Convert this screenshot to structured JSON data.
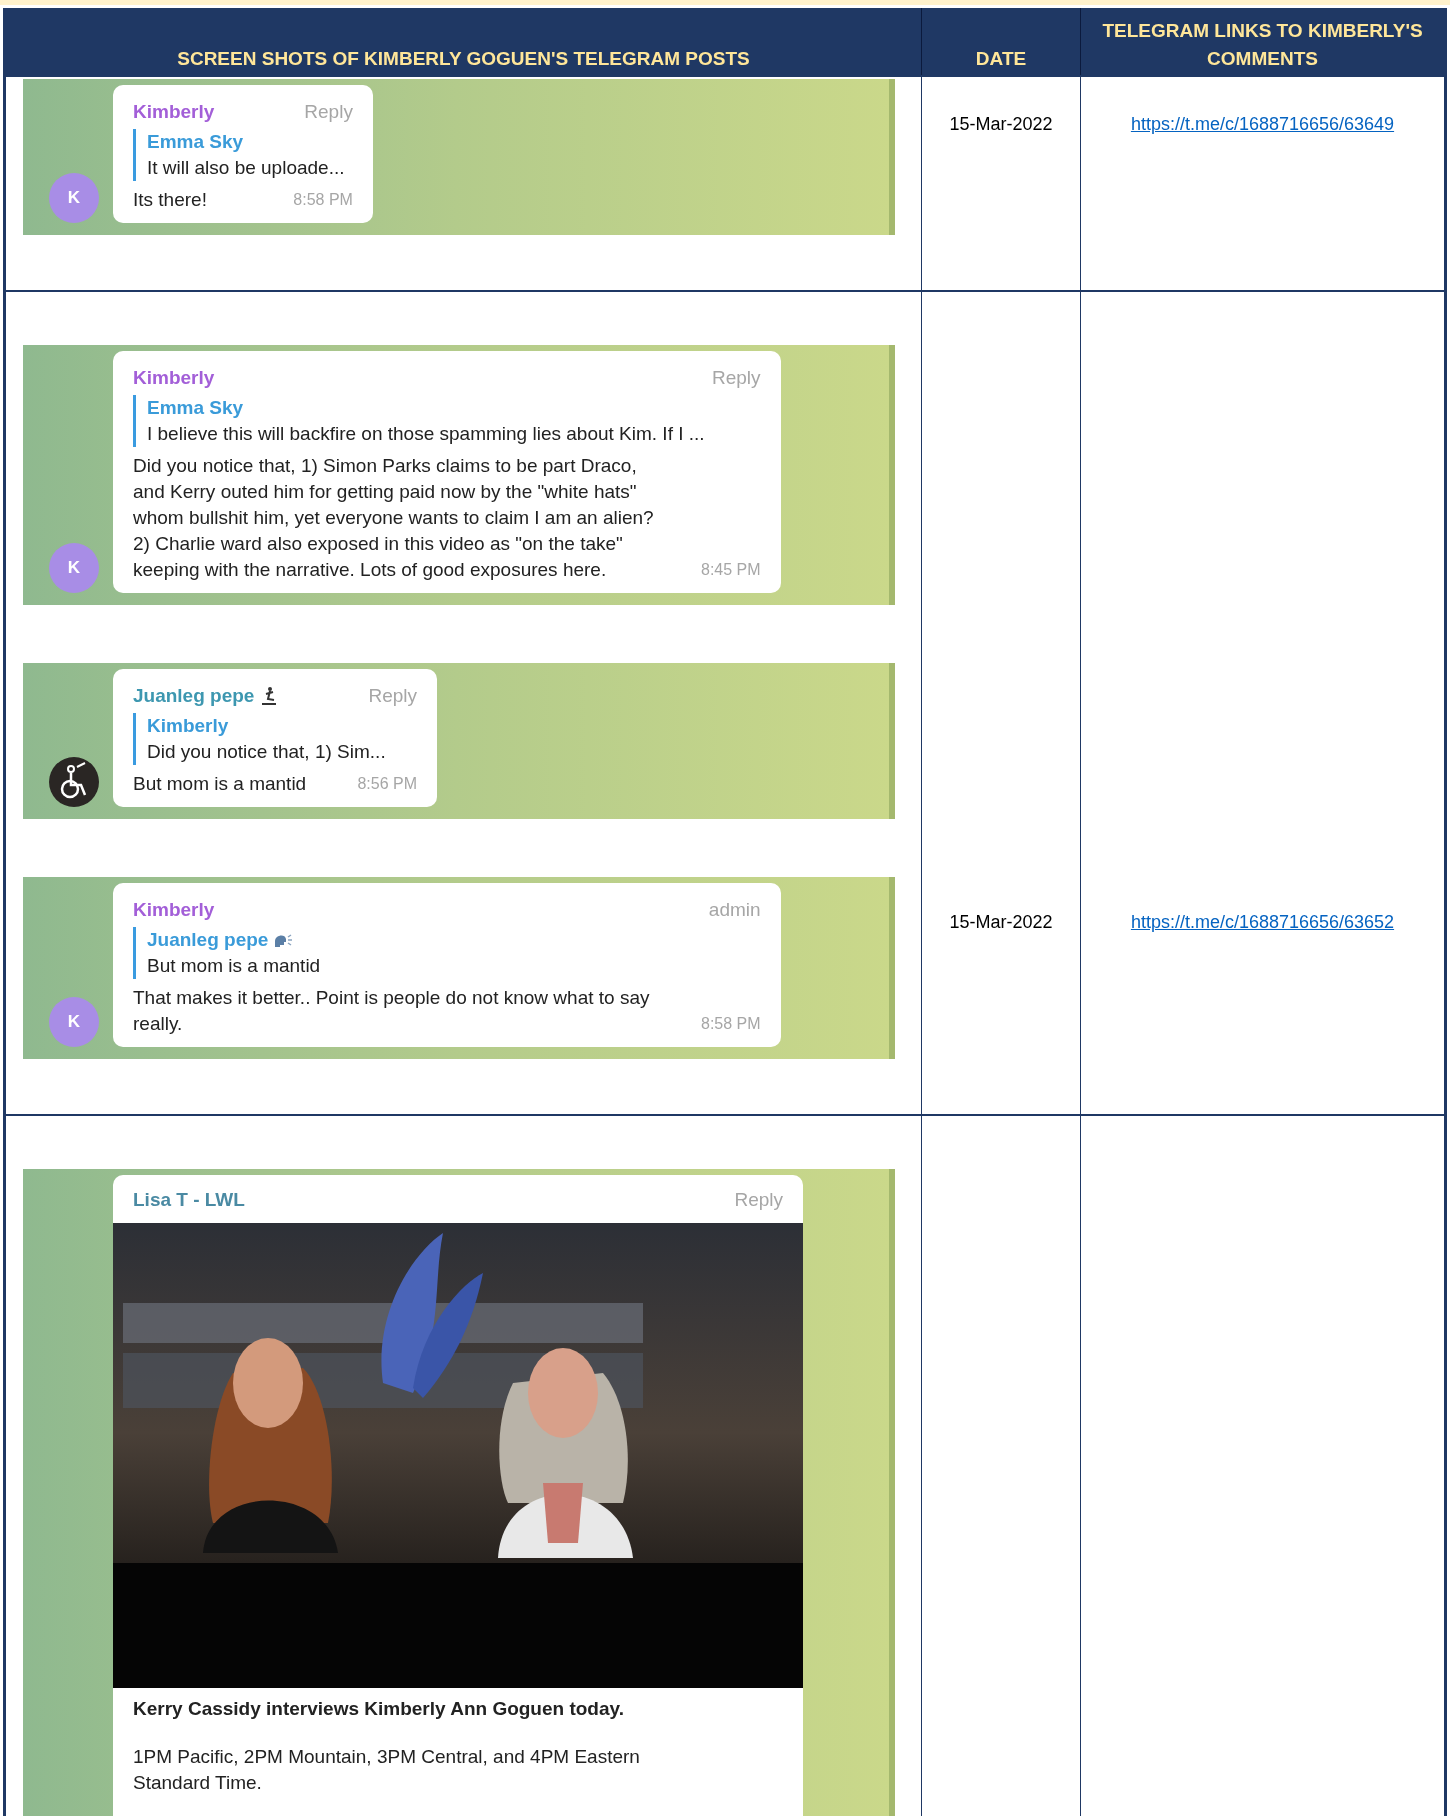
{
  "table": {
    "columns": [
      "SCREEN SHOTS OF KIMBERLY GOGUEN'S TELEGRAM POSTS",
      "DATE",
      "TELEGRAM LINKS TO KIMBERLY'S COMMENTS"
    ],
    "rows": [
      {
        "screenshots": [
          {
            "avatar": {
              "kind": "letter",
              "letter": "K"
            },
            "sender": "Kimberly",
            "color": "#a35fd8",
            "tag": "Reply",
            "quote": {
              "author": "Emma Sky",
              "text": "It will also be uploade..."
            },
            "text": "Its there!",
            "time": "8:58 PM",
            "date": "15-Mar-2022",
            "link": "https://t.me/c/1688716656/63649"
          }
        ]
      },
      {
        "screenshots": [
          {
            "avatar": {
              "kind": "letter",
              "letter": "K"
            },
            "sender": "Kimberly",
            "color": "#a35fd8",
            "tag": "Reply",
            "quote": {
              "author": "Emma Sky",
              "text": "I believe this will backfire on those spamming lies about Kim. If I ..."
            },
            "text": "Did you notice that, 1) Simon Parks claims to be part Draco, and Kerry outed him for getting paid now by the \"white hats\" whom bullshit him, yet everyone wants to claim I am an alien? 2) Charlie ward also exposed in this video as \"on the take\" keeping with the narrative. Lots of good exposures here.",
            "time": "8:45 PM"
          },
          {
            "sender": "Juanleg pepe",
            "sender_icon": true,
            "color": "#3d97b0",
            "tag": "Reply",
            "quote": {
              "author": "Kimberly",
              "text": "Did you notice that, 1) Sim..."
            },
            "text": "But mom is a mantid",
            "time": "8:56 PM"
          },
          {
            "avatar": {
              "kind": "letter",
              "letter": "K"
            },
            "sender": "Kimberly",
            "color": "#a35fd8",
            "tag": "admin",
            "quote": {
              "author": "Juanleg pepe",
              "author_icon": true,
              "text": "But mom is a mantid"
            },
            "text": "That makes it better.. Point is people do not know what to say really.",
            "time": "8:58 PM",
            "date": "15-Mar-2022",
            "link": "https://t.me/c/1688716656/63652"
          }
        ]
      },
      {
        "screenshots": [
          {
            "kind": "media",
            "sender": "Lisa T - LWL",
            "color": "#4a8aa3",
            "tag": "Reply",
            "caption": "Kerry Cassidy interviews Kimberly Ann Goguen today.",
            "text": "1PM Pacific, 2PM Mountain, 3PM Central, and 4PM Eastern Standard Time."
          }
        ]
      }
    ]
  }
}
